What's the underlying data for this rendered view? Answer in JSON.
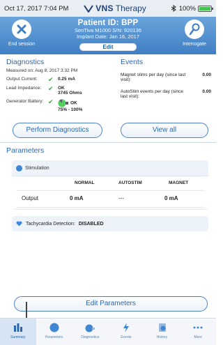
{
  "status_bar": {
    "time": "Oct 17, 2017  7:04 PM",
    "brand_strong": "VNS",
    "brand_rest": "Therapy",
    "battery": "100%"
  },
  "header": {
    "end_session": "End session",
    "patient_id": "Patient ID: BPP",
    "device": "SenTiva M1000 S/N: 920136",
    "implant_date": "Implant Date: Jan 16, 2017",
    "edit": "Edit",
    "interrogate": "Interrogate"
  },
  "diagnostics": {
    "title": "Diagnostics",
    "measured": "Measured on: Aug 8, 2017 3:32 PM",
    "output_current_label": "Output Current:",
    "output_current_value": "0.25 mA",
    "lead_impedance_label": "Lead Impedance:",
    "lead_impedance_status": "OK",
    "lead_impedance_value": "3745 Ohms",
    "battery_label": "Generator Battery:",
    "battery_status": "OK",
    "battery_range": "75% - 100%",
    "battery_level": 0.875,
    "perform_button": "Perform Diagnostics"
  },
  "events": {
    "title": "Events",
    "magnet_label": "Magnet stims per day (since last visit):",
    "magnet_value": "0.00",
    "autostim_label": "AutoStim events per day (since last visit):",
    "autostim_value": "0.00",
    "view_all_button": "View all"
  },
  "parameters": {
    "title": "Parameters",
    "stimulation_label": "Stimulation",
    "columns": [
      "NORMAL",
      "AUTOSTIM",
      "MAGNET"
    ],
    "row_label": "Output",
    "row_values": [
      "0 mA",
      "---",
      "0 mA"
    ],
    "tachy_label": "Tachycardia Detection:",
    "tachy_value": "DISABLED",
    "edit_button": "Edit Parameters"
  },
  "tabs": [
    "Summary",
    "Parameters",
    "Diagnostics",
    "Events",
    "History",
    "More"
  ],
  "colors": {
    "header": "#4a8acb",
    "accent": "#2a67b2",
    "ok_check": "#3da642",
    "battery": "#44c553"
  }
}
